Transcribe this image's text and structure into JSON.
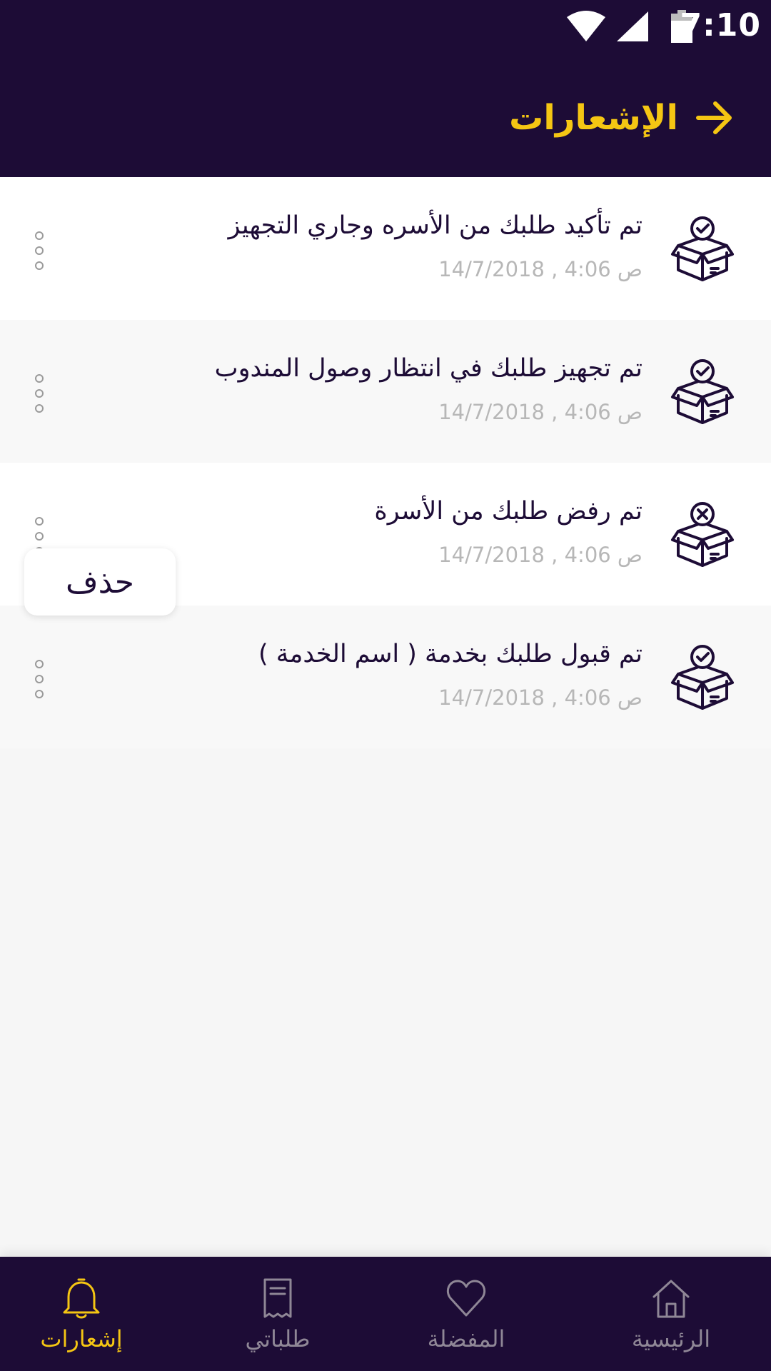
{
  "status_bar": {
    "time": "7:10",
    "icons": [
      "wifi-icon",
      "signal-icon",
      "battery-icon"
    ]
  },
  "header": {
    "title": "الإشعارات",
    "back_icon": "arrow-right-icon",
    "background": "#1d0c36",
    "accent": "#f5c613"
  },
  "notifications": [
    {
      "title": "تم تأكيد طلبك من الأسره وجاري التجهيز",
      "date": "ص 4:06 , 14/7/2018",
      "icon": "box-check-icon",
      "status": "confirmed"
    },
    {
      "title": "تم تجهيز طلبك في انتظار وصول المندوب",
      "date": "ص 4:06 , 14/7/2018",
      "icon": "box-check-icon",
      "status": "prepared"
    },
    {
      "title": "تم رفض طلبك من الأسرة",
      "date": "ص 4:06 , 14/7/2018",
      "icon": "box-x-icon",
      "status": "rejected"
    },
    {
      "title": "تم قبول طلبك بخدمة ( اسم الخدمة )",
      "date": "ص 4:06 , 14/7/2018",
      "icon": "box-check-icon",
      "status": "accepted"
    }
  ],
  "popup": {
    "delete_label": "حذف"
  },
  "bottom_nav": {
    "items": [
      {
        "label": "الرئيسية",
        "icon": "home-icon",
        "active": false
      },
      {
        "label": "المفضلة",
        "icon": "heart-icon",
        "active": false
      },
      {
        "label": "طلباتي",
        "icon": "receipt-icon",
        "active": false
      },
      {
        "label": "إشعارات",
        "icon": "bell-icon",
        "active": true
      }
    ],
    "active_color": "#f5c613",
    "inactive_color": "#8f8796"
  }
}
